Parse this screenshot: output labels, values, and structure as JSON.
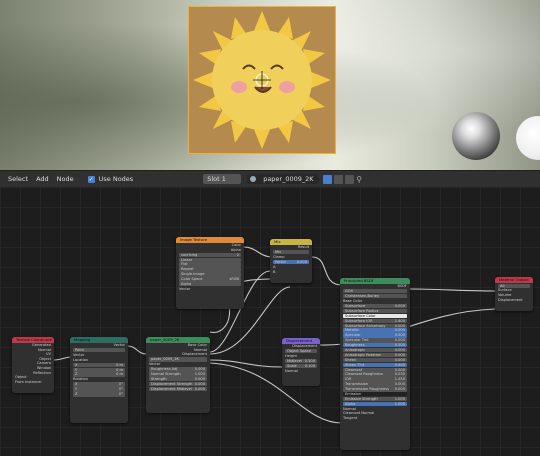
{
  "header": {
    "menu": [
      "Select",
      "Add",
      "Node"
    ],
    "use_nodes_label": "Use Nodes",
    "slot": "Slot 1",
    "image_name": "paper_0009_2K"
  },
  "nodes": {
    "texcoord": {
      "title": "Texture Coordinate",
      "outputs": [
        "Generated",
        "Normal",
        "UV",
        "Object",
        "Camera",
        "Window",
        "Reflection"
      ],
      "object_label": "Object",
      "from_instancer": "From Instancer"
    },
    "mapping": {
      "title": "Mapping",
      "type_label": "Point",
      "vector_out": "Vector",
      "inputs": [
        {
          "label": "Vector",
          "value": ""
        },
        {
          "label": "Location",
          "value": ""
        },
        {
          "label": "X",
          "value": "0 m"
        },
        {
          "label": "Y",
          "value": "0 m"
        },
        {
          "label": "Z",
          "value": "0 m"
        },
        {
          "label": "Rotation",
          "value": ""
        },
        {
          "label": "X",
          "value": "0°"
        },
        {
          "label": "Y",
          "value": "0°"
        },
        {
          "label": "Z",
          "value": "0°"
        }
      ]
    },
    "texture1": {
      "title": "paper_0009_2K",
      "outputs": [
        "Base Color",
        "Normal",
        "Displacement"
      ],
      "image": "paper_0009_2K",
      "vector": "Vector",
      "fields": [
        {
          "label": "Roughness Adj",
          "value": "0.000"
        },
        {
          "label": "Normal Strength",
          "value": "1.000"
        },
        {
          "label": "Strength",
          "value": "0.000"
        },
        {
          "label": "Displacement Strength",
          "value": "0.000"
        },
        {
          "label": "Displacement Midlevel",
          "value": "0.000"
        }
      ]
    },
    "image": {
      "title": "Image Texture",
      "outputs": [
        "Color",
        "Alpha"
      ],
      "image": "sunrising",
      "count": "2",
      "options": [
        "Linear",
        "Flat",
        "Repeat",
        "Single Image"
      ],
      "color_space_label": "Color Space",
      "color_space": "sRGB",
      "alpha_label": "Alpha",
      "vector": "Vector"
    },
    "mix": {
      "title": "Mix",
      "output": "Result",
      "mode": "Mix",
      "clamp": "Clamp",
      "factor_label": "Factor",
      "factor": "0.000",
      "inputs": [
        "A",
        "B"
      ]
    },
    "principled": {
      "title": "Principled BSDF",
      "output": "BSDF",
      "options": [
        "GGX",
        "Christensen-Burley"
      ],
      "fields": [
        {
          "label": "Base Color",
          "value": "",
          "kind": "label"
        },
        {
          "label": "Subsurface",
          "value": "0.000",
          "kind": "normal"
        },
        {
          "label": "Subsurface Radius",
          "value": "",
          "kind": "normal"
        },
        {
          "label": "Subsurface Color",
          "value": "",
          "kind": "white"
        },
        {
          "label": "Subsurface IOR",
          "value": "1.400",
          "kind": "normal"
        },
        {
          "label": "Subsurface Anisotropy",
          "value": "0.000",
          "kind": "normal"
        },
        {
          "label": "Metallic",
          "value": "0.000",
          "kind": "blue"
        },
        {
          "label": "Specular",
          "value": "0.500",
          "kind": "blue"
        },
        {
          "label": "Specular Tint",
          "value": "0.000",
          "kind": "normal"
        },
        {
          "label": "Roughness",
          "value": "0.500",
          "kind": "blue"
        },
        {
          "label": "Anisotropic",
          "value": "0.000",
          "kind": "normal"
        },
        {
          "label": "Anisotropic Rotation",
          "value": "0.000",
          "kind": "normal"
        },
        {
          "label": "Sheen",
          "value": "0.000",
          "kind": "normal"
        },
        {
          "label": "Sheen Tint",
          "value": "0.500",
          "kind": "blue"
        },
        {
          "label": "Clearcoat",
          "value": "0.000",
          "kind": "normal"
        },
        {
          "label": "Clearcoat Roughness",
          "value": "0.030",
          "kind": "normal"
        },
        {
          "label": "IOR",
          "value": "1.450",
          "kind": "normal"
        },
        {
          "label": "Transmission",
          "value": "0.000",
          "kind": "normal"
        },
        {
          "label": "Transmission Roughness",
          "value": "0.000",
          "kind": "normal"
        },
        {
          "label": "Emission",
          "value": "",
          "kind": "dark"
        },
        {
          "label": "Emission Strength",
          "value": "1.000",
          "kind": "normal"
        },
        {
          "label": "Alpha",
          "value": "1.000",
          "kind": "blue"
        },
        {
          "label": "Normal",
          "value": "",
          "kind": "label"
        },
        {
          "label": "Clearcoat Normal",
          "value": "",
          "kind": "label"
        },
        {
          "label": "Tangent",
          "value": "",
          "kind": "label"
        }
      ]
    },
    "displacement": {
      "title": "Displacement",
      "output": "Displacement",
      "space": "Object Space",
      "inputs": [
        {
          "label": "Height",
          "value": ""
        },
        {
          "label": "Midlevel",
          "value": "0.500"
        },
        {
          "label": "Scale",
          "value": "0.100"
        },
        {
          "label": "Normal",
          "value": ""
        }
      ]
    },
    "output": {
      "title": "Material Output",
      "target": "All",
      "inputs": [
        "Surface",
        "Volume",
        "Displacement"
      ]
    }
  },
  "colors": {
    "accent": "#4a7fcf",
    "link": "#c7c7c7",
    "plane_border": "#f0b040"
  }
}
